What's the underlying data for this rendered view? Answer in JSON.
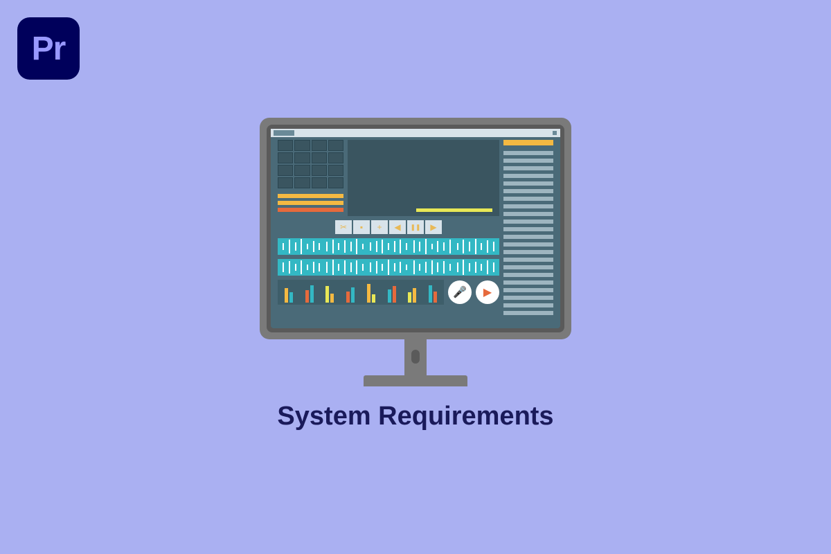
{
  "app_icon": {
    "label": "Pr"
  },
  "caption": "System Requirements",
  "controls": {
    "scissors": "✂",
    "note": "▪",
    "plus": "+",
    "prev": "◀",
    "pause": "❚❚",
    "next": "▶"
  },
  "buttons": {
    "mic": "🎤",
    "play": "▶"
  },
  "colors": {
    "background": "#aab0f2",
    "icon_bg": "#00005b",
    "icon_text": "#9999ff",
    "caption_text": "#1a1a5a",
    "accent_orange": "#f4b942",
    "accent_teal": "#33b8c4"
  }
}
